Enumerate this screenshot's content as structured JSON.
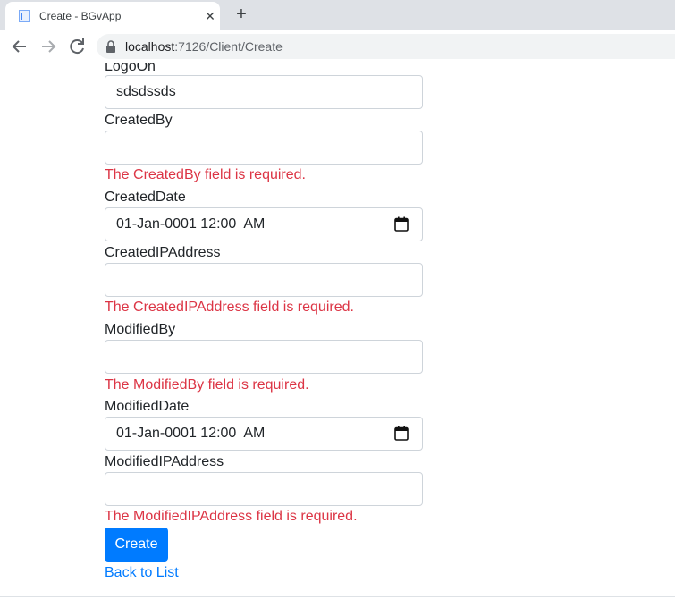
{
  "browser": {
    "tab_title": "Create - BGvApp",
    "close_glyph": "✕",
    "new_tab_glyph": "+",
    "url_host": "localhost",
    "url_rest": ":7126/Client/Create"
  },
  "form": {
    "logon": {
      "label": "LogoOn",
      "value": "sdsdssds"
    },
    "created_by": {
      "label": "CreatedBy",
      "value": "",
      "error": "The CreatedBy field is required."
    },
    "created_date": {
      "label": "CreatedDate",
      "value": "01-Jan-0001 12:00  AM"
    },
    "created_ip": {
      "label": "CreatedIPAddress",
      "value": "",
      "error": "The CreatedIPAddress field is required."
    },
    "modified_by": {
      "label": "ModifiedBy",
      "value": "",
      "error": "The ModifiedBy field is required."
    },
    "modified_date": {
      "label": "ModifiedDate",
      "value": "01-Jan-0001 12:00  AM"
    },
    "modified_ip": {
      "label": "ModifiedIPAddress",
      "value": "",
      "error": "The ModifiedIPAddress field is required."
    },
    "create_label": "Create",
    "back_label": "Back to List"
  },
  "colors": {
    "primary": "#007bff",
    "error": "#dc3545",
    "border": "#ced4da"
  },
  "icons": {
    "back": "arrow-left-icon",
    "forward": "arrow-right-icon",
    "reload": "reload-icon",
    "lock": "lock-icon",
    "calendar": "calendar-icon"
  }
}
